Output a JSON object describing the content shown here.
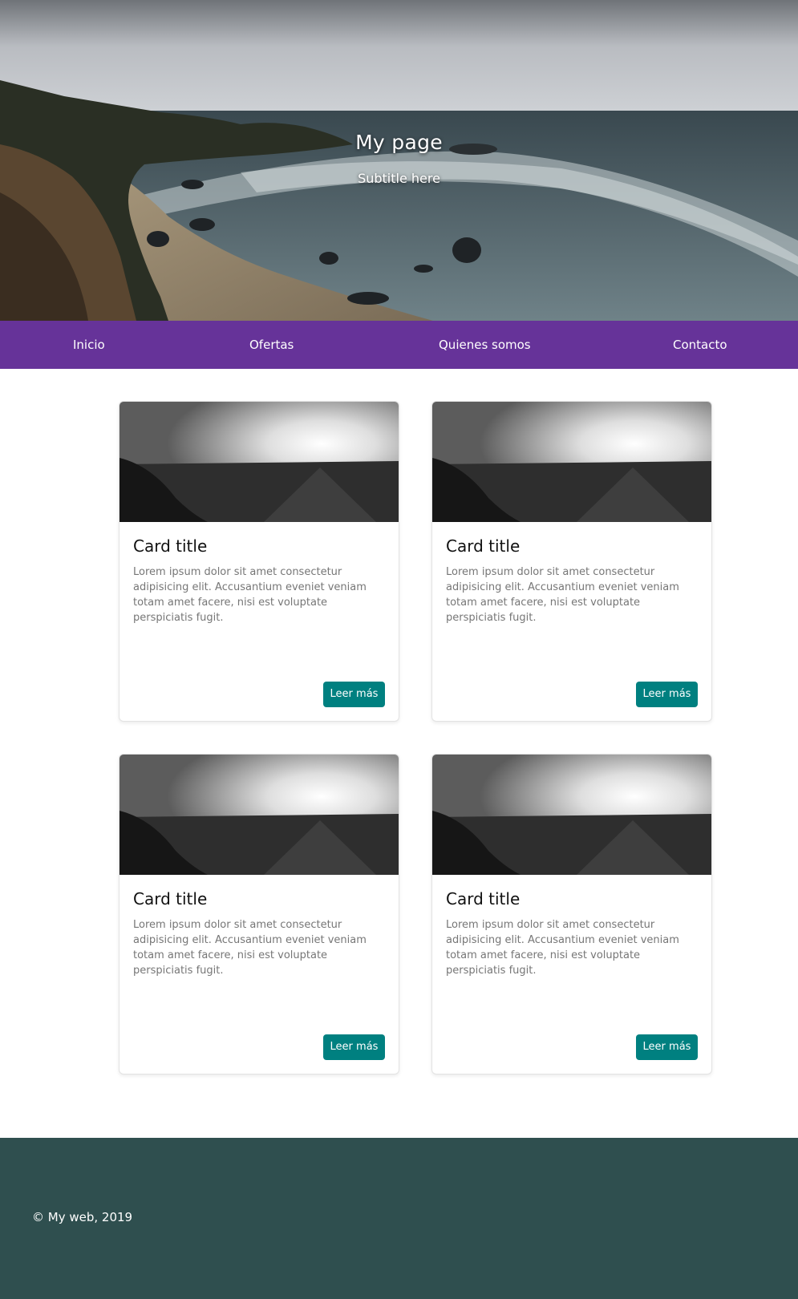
{
  "hero": {
    "title": "My page",
    "subtitle": "Subtitle here"
  },
  "nav": {
    "items": [
      {
        "label": "Inicio"
      },
      {
        "label": "Ofertas"
      },
      {
        "label": "Quienes somos"
      },
      {
        "label": "Contacto"
      }
    ]
  },
  "cards": [
    {
      "title": "Card title",
      "text": "Lorem ipsum dolor sit amet consectetur adipisicing elit. Accusantium eveniet veniam totam amet facere, nisi est voluptate perspiciatis fugit.",
      "button": "Leer más"
    },
    {
      "title": "Card title",
      "text": "Lorem ipsum dolor sit amet consectetur adipisicing elit. Accusantium eveniet veniam totam amet facere, nisi est voluptate perspiciatis fugit.",
      "button": "Leer más"
    },
    {
      "title": "Card title",
      "text": "Lorem ipsum dolor sit amet consectetur adipisicing elit. Accusantium eveniet veniam totam amet facere, nisi est voluptate perspiciatis fugit.",
      "button": "Leer más"
    },
    {
      "title": "Card title",
      "text": "Lorem ipsum dolor sit amet consectetur adipisicing elit. Accusantium eveniet veniam totam amet facere, nisi est voluptate perspiciatis fugit.",
      "button": "Leer más"
    }
  ],
  "footer": {
    "text": "© My web, 2019"
  },
  "colors": {
    "nav_background": "#663399",
    "button_background": "#008080",
    "footer_background": "#2f4f4f"
  }
}
